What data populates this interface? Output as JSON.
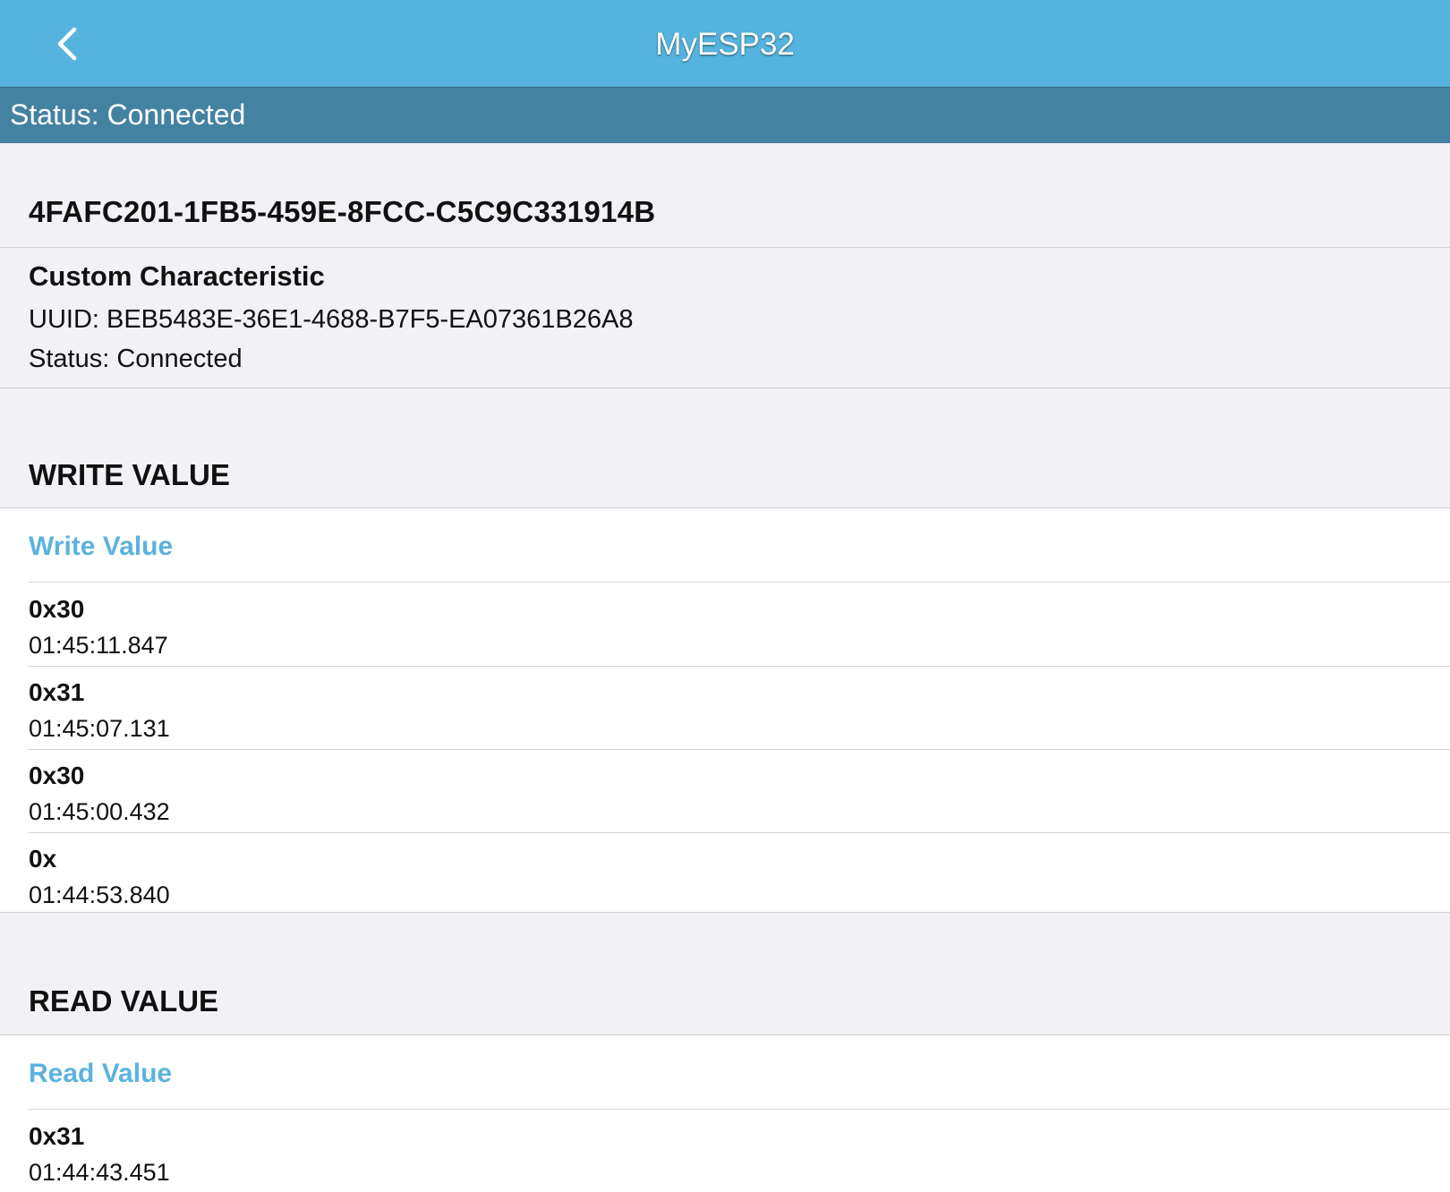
{
  "nav": {
    "title": "MyESP32",
    "back_icon": "chevron-left-icon"
  },
  "status_bar": {
    "text": "Status: Connected"
  },
  "service": {
    "uuid": "4FAFC201-1FB5-459E-8FCC-C5C9C331914B"
  },
  "characteristic": {
    "name": "Custom Characteristic",
    "uuid": "UUID: BEB5483E-36E1-4688-B7F5-EA07361B26A8",
    "status": "Status: Connected"
  },
  "write_section": {
    "header": "WRITE VALUE",
    "action_label": "Write Value",
    "entries": [
      {
        "value": "0x30",
        "time": "01:45:11.847"
      },
      {
        "value": "0x31",
        "time": "01:45:07.131"
      },
      {
        "value": "0x30",
        "time": "01:45:00.432"
      },
      {
        "value": "0x",
        "time": "01:44:53.840"
      }
    ]
  },
  "read_section": {
    "header": "READ VALUE",
    "action_label": "Read Value",
    "entries": [
      {
        "value": "0x31",
        "time": "01:44:43.451"
      }
    ]
  },
  "colors": {
    "nav_bg": "#55b4dd",
    "status_bg": "#4482a2",
    "accent": "#5cb2dc",
    "page_bg": "#f1f1f6"
  }
}
